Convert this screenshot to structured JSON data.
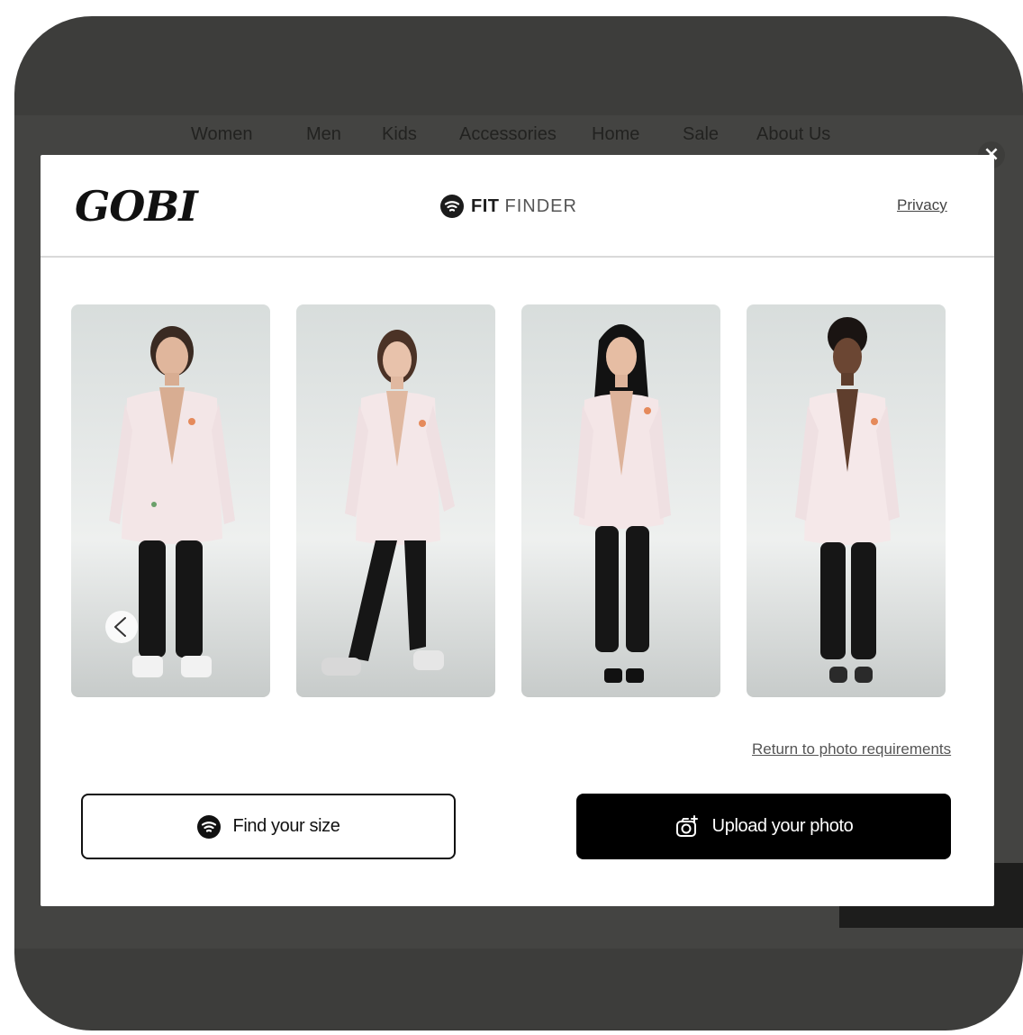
{
  "background": {
    "nav_items": [
      "Women",
      "Men",
      "Kids",
      "Accessories",
      "Home",
      "Sale",
      "About Us"
    ]
  },
  "modal": {
    "close_label": "×",
    "logo": "GOBI",
    "fit_finder": {
      "bold": "FIT",
      "light": "FINDER"
    },
    "privacy_link": "Privacy",
    "return_link": "Return to photo requirements",
    "find_size_button": "Find your size",
    "upload_button": "Upload your photo"
  },
  "models": [
    {
      "hair": "short-brown",
      "shoes": "sneakers"
    },
    {
      "hair": "long-brown",
      "shoes": "sneakers"
    },
    {
      "hair": "long-black",
      "shoes": "heels"
    },
    {
      "hair": "afro",
      "shoes": "flats"
    }
  ],
  "icons": [
    "close-icon",
    "fit-finder-icon",
    "chevron-left-icon",
    "camera-plus-icon"
  ],
  "colors": {
    "overlay": "#3d3d3b",
    "button_dark": "#000000",
    "text_dark": "#111111"
  }
}
